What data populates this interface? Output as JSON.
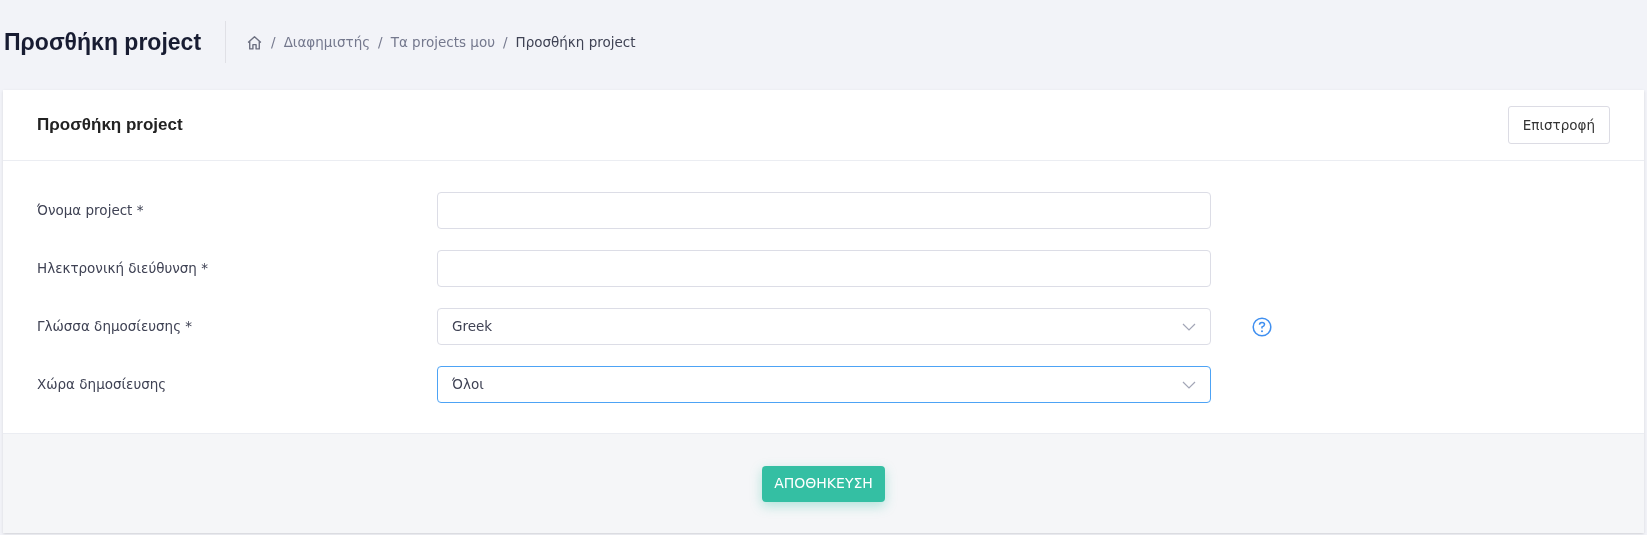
{
  "page_title": "Προσθήκη project",
  "breadcrumb": [
    {
      "separator": "/",
      "label": "Διαφημιστής"
    },
    {
      "separator": "/",
      "label": "Τα projects μου"
    },
    {
      "separator": "/",
      "label": "Προσθήκη project"
    }
  ],
  "card": {
    "title": "Προσθήκη project",
    "back_button": "Επιστροφή"
  },
  "fields": [
    {
      "label": "Όνομα project *",
      "kind": "text",
      "focused": false,
      "help": false
    },
    {
      "label": "Ηλεκτρονική διεύθυνση *",
      "kind": "text",
      "focused": false,
      "help": false
    },
    {
      "label": "Γλώσσα δημοσίευσης *",
      "kind": "select",
      "value": "Greek",
      "focused": false,
      "help": true
    },
    {
      "label": "Χώρα δημοσίευσης",
      "kind": "select",
      "value": "Όλοι",
      "focused": true,
      "help": false
    }
  ],
  "save_button": "ΑΠΟΘΗΚΕΥΣΗ"
}
